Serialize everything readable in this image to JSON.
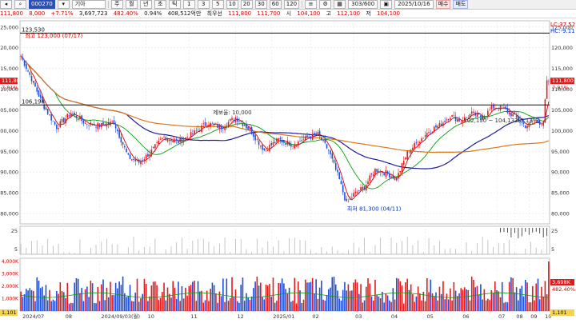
{
  "toolbar": {
    "stock_code": "000270",
    "stock_name": "기아",
    "period_buttons": [
      "주",
      "월",
      "년",
      "초",
      "틱",
      "1",
      "3",
      "5",
      "10",
      "20",
      "30",
      "60",
      "120"
    ],
    "count_value": "303/600",
    "date_value": "2025/10/16",
    "buy_label": "매수",
    "sell_label": "매도"
  },
  "info": {
    "price": "111,800",
    "change": "8,000",
    "change_pct": "+7.71%",
    "volume": "3,697,723",
    "volume_ratio": "482.40%",
    "turnover_ratio": "0.94%",
    "amount": "408,512억만",
    "prev_label": "최우선",
    "prev_ask": "111,800",
    "prev_bid": "111,700",
    "open_label": "시",
    "open": "104,100",
    "high_label": "고",
    "high": "112,100",
    "low_label": "저",
    "low": "104,100"
  },
  "legend": {
    "lc": "LC:37.52",
    "hc": "HC:-9.11"
  },
  "chart_data": {
    "type": "candlestick",
    "x_ticks": [
      "2024/07",
      "08",
      "2024/09/03(월)",
      "10",
      "11",
      "12",
      "2025/01",
      "02",
      "03",
      "04",
      "05",
      "06",
      "07",
      "08",
      "09",
      "10"
    ],
    "y_ticks": [
      125000,
      120000,
      115000,
      110000,
      105000,
      100000,
      95000,
      90000,
      85000,
      80000
    ],
    "ylim": [
      77500,
      126500
    ],
    "hlines": [
      {
        "value": 123530,
        "label": "123,530"
      },
      {
        "value": 106194,
        "label": "106,194"
      }
    ],
    "annotations": [
      {
        "text": "최고 123,000 (07/17)",
        "x": 1,
        "y": 123000,
        "color": "#d20000"
      },
      {
        "text": "최저 81,300 (04/11)",
        "x": 181,
        "y": 81300,
        "color": "#0031c8"
      },
      {
        "text": "제보율: 10,000",
        "x": 106,
        "y": 104500,
        "color": "#333333"
      },
      {
        "text": "102,150 ~ 104,133(5.13%)",
        "x": 246,
        "y": 102600,
        "color": "#333333"
      }
    ],
    "price_badges": [
      {
        "side": "right",
        "text": "111,800",
        "sub": "7.81%"
      },
      {
        "side": "left",
        "text": "111,800",
        "sub": "7.81%"
      }
    ],
    "close_keypoints": [
      [
        0,
        118000
      ],
      [
        6,
        112500
      ],
      [
        12,
        106500
      ],
      [
        20,
        100800
      ],
      [
        28,
        104300
      ],
      [
        36,
        101800
      ],
      [
        44,
        101200
      ],
      [
        52,
        102000
      ],
      [
        60,
        93600
      ],
      [
        66,
        92300
      ],
      [
        72,
        94600
      ],
      [
        80,
        98500
      ],
      [
        88,
        97300
      ],
      [
        96,
        99200
      ],
      [
        104,
        101800
      ],
      [
        112,
        100800
      ],
      [
        120,
        103200
      ],
      [
        128,
        100200
      ],
      [
        136,
        95300
      ],
      [
        144,
        97800
      ],
      [
        152,
        96600
      ],
      [
        160,
        98300
      ],
      [
        166,
        99100
      ],
      [
        172,
        95200
      ],
      [
        178,
        88100
      ],
      [
        182,
        82300
      ],
      [
        186,
        84600
      ],
      [
        192,
        86400
      ],
      [
        198,
        90600
      ],
      [
        204,
        89800
      ],
      [
        210,
        88400
      ],
      [
        216,
        94700
      ],
      [
        222,
        97300
      ],
      [
        228,
        99900
      ],
      [
        234,
        101300
      ],
      [
        240,
        103600
      ],
      [
        246,
        102300
      ],
      [
        252,
        104100
      ],
      [
        258,
        103200
      ],
      [
        264,
        105700
      ],
      [
        270,
        105200
      ],
      [
        276,
        103400
      ],
      [
        282,
        101200
      ],
      [
        288,
        102000
      ],
      [
        292,
        102100
      ],
      [
        294,
        111800
      ]
    ],
    "ma_series": [
      {
        "name": "MA5",
        "color": "#d20000"
      },
      {
        "name": "MA20",
        "color": "#0a9d0a"
      },
      {
        "name": "MA60",
        "color": "#1d1d9a"
      },
      {
        "name": "MA120",
        "color": "#d87a1d"
      }
    ],
    "subpanel1": {
      "y_ticks": [
        5,
        25
      ]
    },
    "subpanel2": {
      "y_ticks": [
        "4,000K",
        "3,000K",
        "2,000K",
        "1,000K"
      ],
      "badge": "3,698K",
      "badge_sub": "482.40%",
      "left_badge": "1,101",
      "right_badge": "1,101"
    }
  }
}
